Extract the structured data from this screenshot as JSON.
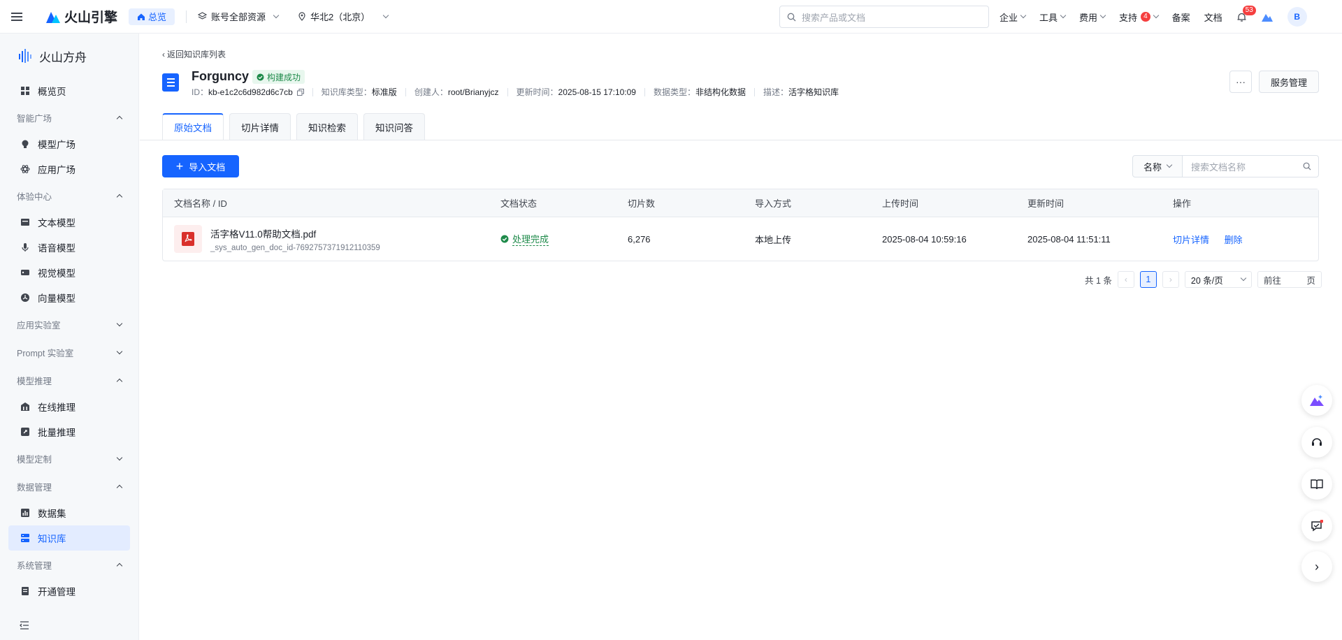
{
  "topbar": {
    "brand": "火山引擎",
    "overview": "总览",
    "account_select": "账号全部资源",
    "region_select": "华北2（北京）",
    "search_placeholder": "搜索产品或文档",
    "menu": [
      "企业",
      "工具",
      "费用",
      "支持"
    ],
    "support_badge": "4",
    "filing": "备案",
    "docs": "文档",
    "notify_badge": "53",
    "avatar": "B"
  },
  "sidebar": {
    "brand": "火山方舟",
    "overview": "概览页",
    "groups": {
      "g1": "智能广场",
      "g2": "体验中心",
      "g3": "应用实验室",
      "g4": "Prompt 实验室",
      "g5": "模型推理",
      "g6": "模型定制",
      "g7": "数据管理",
      "g8": "系统管理"
    },
    "items": {
      "model_square": "模型广场",
      "app_square": "应用广场",
      "text_model": "文本模型",
      "voice_model": "语音模型",
      "vision_model": "视觉模型",
      "vector_model": "向量模型",
      "online_inference": "在线推理",
      "batch_inference": "批量推理",
      "dataset": "数据集",
      "knowledge_base": "知识库",
      "activation": "开通管理"
    }
  },
  "header": {
    "back": "返回知识库列表",
    "title": "Forguncy",
    "status": "构建成功",
    "id_label": "ID：",
    "id_value": "kb-e1c2c6d982d6c7cb",
    "type_label": "知识库类型：",
    "type_value": "标准版",
    "creator_label": "创建人：",
    "creator_value": "root/Brianyjcz",
    "updated_label": "更新时间：",
    "updated_value": "2025-08-15 17:10:09",
    "data_type_label": "数据类型：",
    "data_type_value": "非结构化数据",
    "desc_label": "描述：",
    "desc_value": "活字格知识库",
    "more": "···",
    "service_btn": "服务管理"
  },
  "tabs": [
    "原始文档",
    "切片详情",
    "知识检索",
    "知识问答"
  ],
  "toolbar": {
    "import_btn": "导入文档",
    "filter_select": "名称",
    "search_placeholder": "搜索文档名称"
  },
  "table": {
    "headers": [
      "文档名称 / ID",
      "文档状态",
      "切片数",
      "导入方式",
      "上传时间",
      "更新时间",
      "操作"
    ],
    "rows": [
      {
        "name": "活字格V11.0帮助文档.pdf",
        "id": "_sys_auto_gen_doc_id-7692757371912110359",
        "status": "处理完成",
        "chunks": "6,276",
        "import_method": "本地上传",
        "uploaded": "2025-08-04 10:59:16",
        "updated": "2025-08-04 11:51:11",
        "action_detail": "切片详情",
        "action_delete": "删除"
      }
    ]
  },
  "pager": {
    "total": "共 1 条",
    "current": "1",
    "page_size": "20 条/页",
    "goto": "前往",
    "page_unit": "页"
  },
  "colors": {
    "primary": "#1664ff",
    "success": "#1e8a4a",
    "danger": "#f53f3f"
  }
}
